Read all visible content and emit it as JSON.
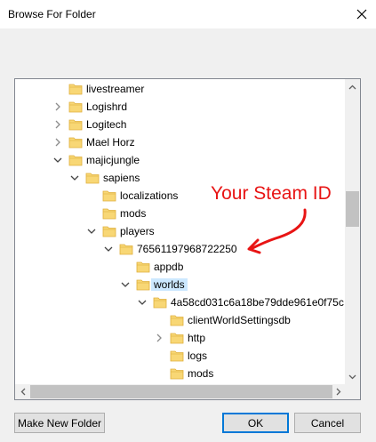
{
  "window": {
    "title": "Browse For Folder"
  },
  "tree": {
    "items": [
      {
        "label": "livestreamer",
        "expander": "none"
      },
      {
        "label": "Logishrd",
        "expander": "collapsed"
      },
      {
        "label": "Logitech",
        "expander": "collapsed"
      },
      {
        "label": "Mael Horz",
        "expander": "collapsed"
      },
      {
        "label": "majicjungle",
        "expander": "expanded"
      },
      {
        "label": "sapiens",
        "expander": "expanded"
      },
      {
        "label": "localizations",
        "expander": "none"
      },
      {
        "label": "mods",
        "expander": "none"
      },
      {
        "label": "players",
        "expander": "expanded"
      },
      {
        "label": "76561197968722250",
        "expander": "expanded"
      },
      {
        "label": "appdb",
        "expander": "none"
      },
      {
        "label": "worlds",
        "expander": "expanded",
        "selected": true
      },
      {
        "label": "4a58cd031c6a18be79dde961e0f75c",
        "expander": "expanded"
      },
      {
        "label": "clientWorldSettingsdb",
        "expander": "none"
      },
      {
        "label": "http",
        "expander": "collapsed"
      },
      {
        "label": "logs",
        "expander": "none"
      },
      {
        "label": "mods",
        "expander": "none"
      }
    ]
  },
  "annotation": {
    "text": "Your Steam ID",
    "color": "#e81414"
  },
  "buttons": {
    "new_folder": "Make New Folder",
    "ok": "OK",
    "cancel": "Cancel"
  },
  "colors": {
    "folder": "#f8d775",
    "folder_dark": "#e0b03c",
    "selection": "#cce8ff"
  }
}
